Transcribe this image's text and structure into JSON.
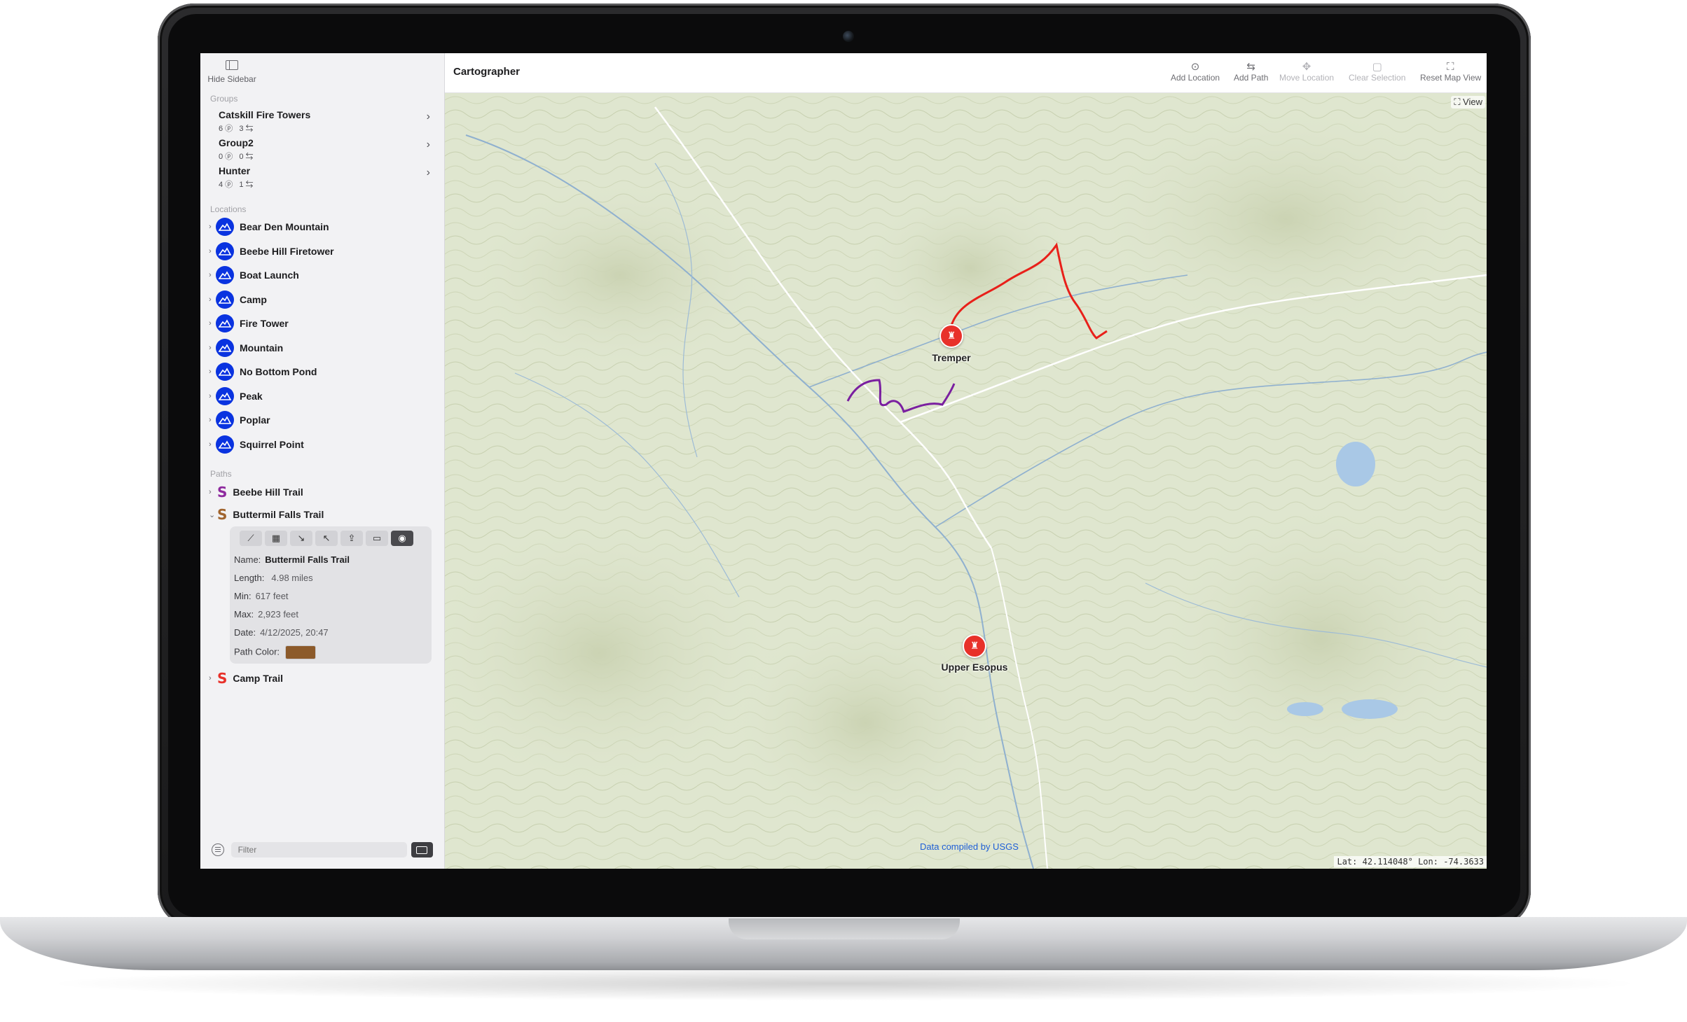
{
  "app": {
    "title": "Cartographer"
  },
  "sidebar": {
    "hide_label": "Hide Sidebar",
    "groups_title": "Groups",
    "groups": [
      {
        "name": "Catskill Fire Towers",
        "locations": "6",
        "paths": "3"
      },
      {
        "name": "Group2",
        "locations": "0",
        "paths": "0"
      },
      {
        "name": "Hunter",
        "locations": "4",
        "paths": "1"
      }
    ],
    "locations_title": "Locations",
    "locations": [
      {
        "name": "Bear Den Mountain"
      },
      {
        "name": "Beebe Hill Firetower"
      },
      {
        "name": "Boat Launch"
      },
      {
        "name": "Camp"
      },
      {
        "name": "Fire Tower"
      },
      {
        "name": "Mountain"
      },
      {
        "name": "No Bottom Pond"
      },
      {
        "name": "Peak"
      },
      {
        "name": "Poplar"
      },
      {
        "name": "Squirrel Point"
      }
    ],
    "paths_title": "Paths",
    "paths": [
      {
        "name": "Beebe Hill Trail",
        "color": "#8e2a9e",
        "expanded": false
      },
      {
        "name": "Buttermil Falls Trail",
        "color": "#a0642e",
        "expanded": true
      },
      {
        "name": "Camp Trail",
        "color": "#e8312a",
        "expanded": false
      }
    ],
    "detail": {
      "name_label": "Name:",
      "name_value": "Buttermil Falls Trail",
      "length_label": "Length:",
      "length_value": "4.98 miles",
      "min_label": "Min:",
      "min_value": "617 feet",
      "max_label": "Max:",
      "max_value": "2,923 feet",
      "date_label": "Date:",
      "date_value": "4/12/2025, 20:47",
      "color_label": "Path Color:",
      "color_value": "#8c5a2a"
    },
    "filter_placeholder": "Filter"
  },
  "toolbar": {
    "add_location": "Add Location",
    "add_path": "Add Path",
    "move_location": "Move Location",
    "clear_selection": "Clear Selection",
    "reset_map_view": "Reset Map View"
  },
  "map": {
    "view_label": "View",
    "markers": [
      {
        "name": "Tremper"
      },
      {
        "name": "Upper Esopus"
      }
    ],
    "credit": "Data compiled by USGS",
    "coords": "Lat: 42.114048° Lon: -74.3633"
  },
  "colors": {
    "location_marker": "#0a33e0",
    "pin": "#e8312a",
    "trail_red": "#e8201a",
    "trail_purple": "#7a1fa0",
    "map_bg": "#dfe6cf"
  }
}
